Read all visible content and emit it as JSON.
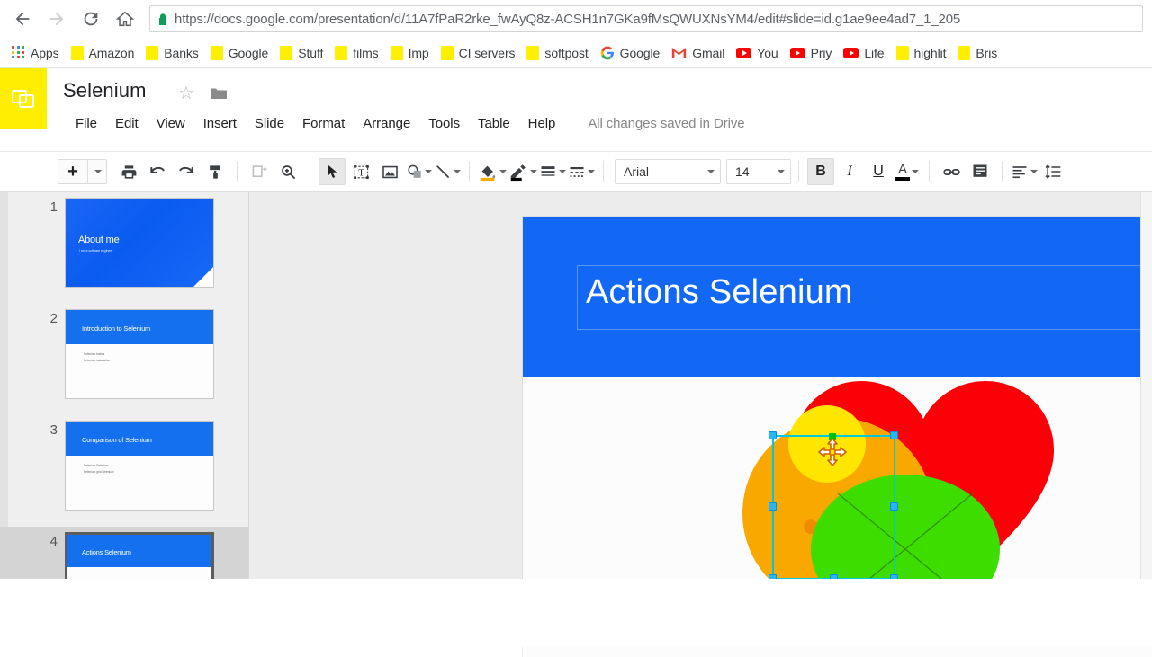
{
  "browser": {
    "back_label": "Back",
    "forward_label": "Forward",
    "reload_label": "Reload",
    "home_label": "Home",
    "url_secure_prefix": "https://",
    "url_host": "docs.google.com",
    "url_path": "/presentation/d/11A7fPaR2rke_fwAyQ8z-ACSH1n7GKa9fMsQWUXNsYM4/edit#slide=id.g1ae9ee4ad7_1_205",
    "url_full": "https://docs.google.com/presentation/d/11A7fPaR2rke_fwAyQ8z-ACSH1n7GKa9fMsQWUXNsYM4/edit#slide=id.g1ae9ee4ad7_1_205",
    "lock_color": "#0f9d58"
  },
  "bookmarks": [
    {
      "label": "Apps",
      "icon": "apps-grid-icon"
    },
    {
      "label": "Amazon",
      "icon": "folder-icon"
    },
    {
      "label": "Banks",
      "icon": "folder-icon"
    },
    {
      "label": "Google",
      "icon": "folder-icon"
    },
    {
      "label": "Stuff",
      "icon": "folder-icon"
    },
    {
      "label": "films",
      "icon": "folder-icon"
    },
    {
      "label": "Imp",
      "icon": "folder-icon"
    },
    {
      "label": "CI servers",
      "icon": "folder-icon"
    },
    {
      "label": "softpost",
      "icon": "folder-icon"
    },
    {
      "label": "Google",
      "icon": "google-g-icon"
    },
    {
      "label": "Gmail",
      "icon": "gmail-icon"
    },
    {
      "label": "You",
      "icon": "youtube-icon"
    },
    {
      "label": "Priy",
      "icon": "youtube-icon"
    },
    {
      "label": "Life",
      "icon": "youtube-icon"
    },
    {
      "label": "highlit",
      "icon": "folder-icon"
    },
    {
      "label": "Bris",
      "icon": "folder-icon"
    }
  ],
  "app": {
    "logo_icon": "google-slides-icon",
    "logo_color": "#ffee00",
    "doc_title": "Selenium",
    "star_icon": "star-outline-icon",
    "folder_icon": "move-to-folder-icon",
    "save_status": "All changes saved in Drive",
    "menus": [
      "File",
      "Edit",
      "View",
      "Insert",
      "Slide",
      "Format",
      "Arrange",
      "Tools",
      "Table",
      "Help"
    ]
  },
  "toolbar": {
    "new_slide_label": "+",
    "items": [
      {
        "name": "print-icon",
        "label": ""
      },
      {
        "name": "undo-icon",
        "label": ""
      },
      {
        "name": "redo-icon",
        "label": ""
      },
      {
        "name": "paint-format-icon",
        "label": ""
      },
      {
        "name": "layout-icon",
        "label": ""
      },
      {
        "name": "zoom-icon",
        "label": ""
      },
      {
        "name": "select-cursor-icon",
        "label": ""
      },
      {
        "name": "text-box-icon",
        "label": ""
      },
      {
        "name": "insert-image-icon",
        "label": ""
      },
      {
        "name": "shape-icon",
        "label": ""
      },
      {
        "name": "line-icon",
        "label": ""
      },
      {
        "name": "fill-color-icon",
        "label": ""
      },
      {
        "name": "border-color-icon",
        "label": ""
      },
      {
        "name": "border-weight-icon",
        "label": ""
      },
      {
        "name": "border-dash-icon",
        "label": ""
      }
    ],
    "font_family": "Arial",
    "font_size": "14",
    "bold_label": "B",
    "italic_label": "I",
    "underline_label": "U",
    "text_color_label": "A",
    "link_icon": "insert-link-icon",
    "comment_icon": "insert-comment-icon",
    "align_icon": "align-left-icon",
    "line_spacing_icon": "line-spacing-icon",
    "fill_color": "#f9ab00",
    "text_color": "#000000",
    "active_tool": "select-cursor-icon"
  },
  "filmstrip": {
    "slides": [
      {
        "number": "1",
        "title": "About me",
        "subtitle": "I am a software engineer",
        "layout": "title-full-blue",
        "selected": false
      },
      {
        "number": "2",
        "title": "Introduction to Selenium",
        "bullets": [
          "Selenium basics",
          "Selenium installation"
        ],
        "layout": "title-and-body",
        "selected": false
      },
      {
        "number": "3",
        "title": "Comparison of Selenium",
        "bullets": [
          "Selenium Selenium",
          "Selenium grid Selenium"
        ],
        "layout": "title-and-body",
        "selected": false
      },
      {
        "number": "4",
        "title": "Actions Selenium",
        "bullets": [],
        "layout": "title-and-shapes",
        "selected": true
      }
    ]
  },
  "canvas": {
    "slide_title": "Actions Selenium",
    "band_color": "#1268f4",
    "background": "#fcfcfc",
    "shapes": [
      {
        "name": "heart-shape",
        "color": "#fb0007"
      },
      {
        "name": "orange-circle-shape",
        "color": "#f9a800"
      },
      {
        "name": "yellow-circle-shape",
        "color": "#ffe600"
      },
      {
        "name": "green-ellipse-shape",
        "color": "#3ddd00"
      }
    ],
    "selection": {
      "handle_color": "#29b6f6",
      "cursor": "move-cursor",
      "selected_shape": "orange-circle-shape"
    }
  }
}
